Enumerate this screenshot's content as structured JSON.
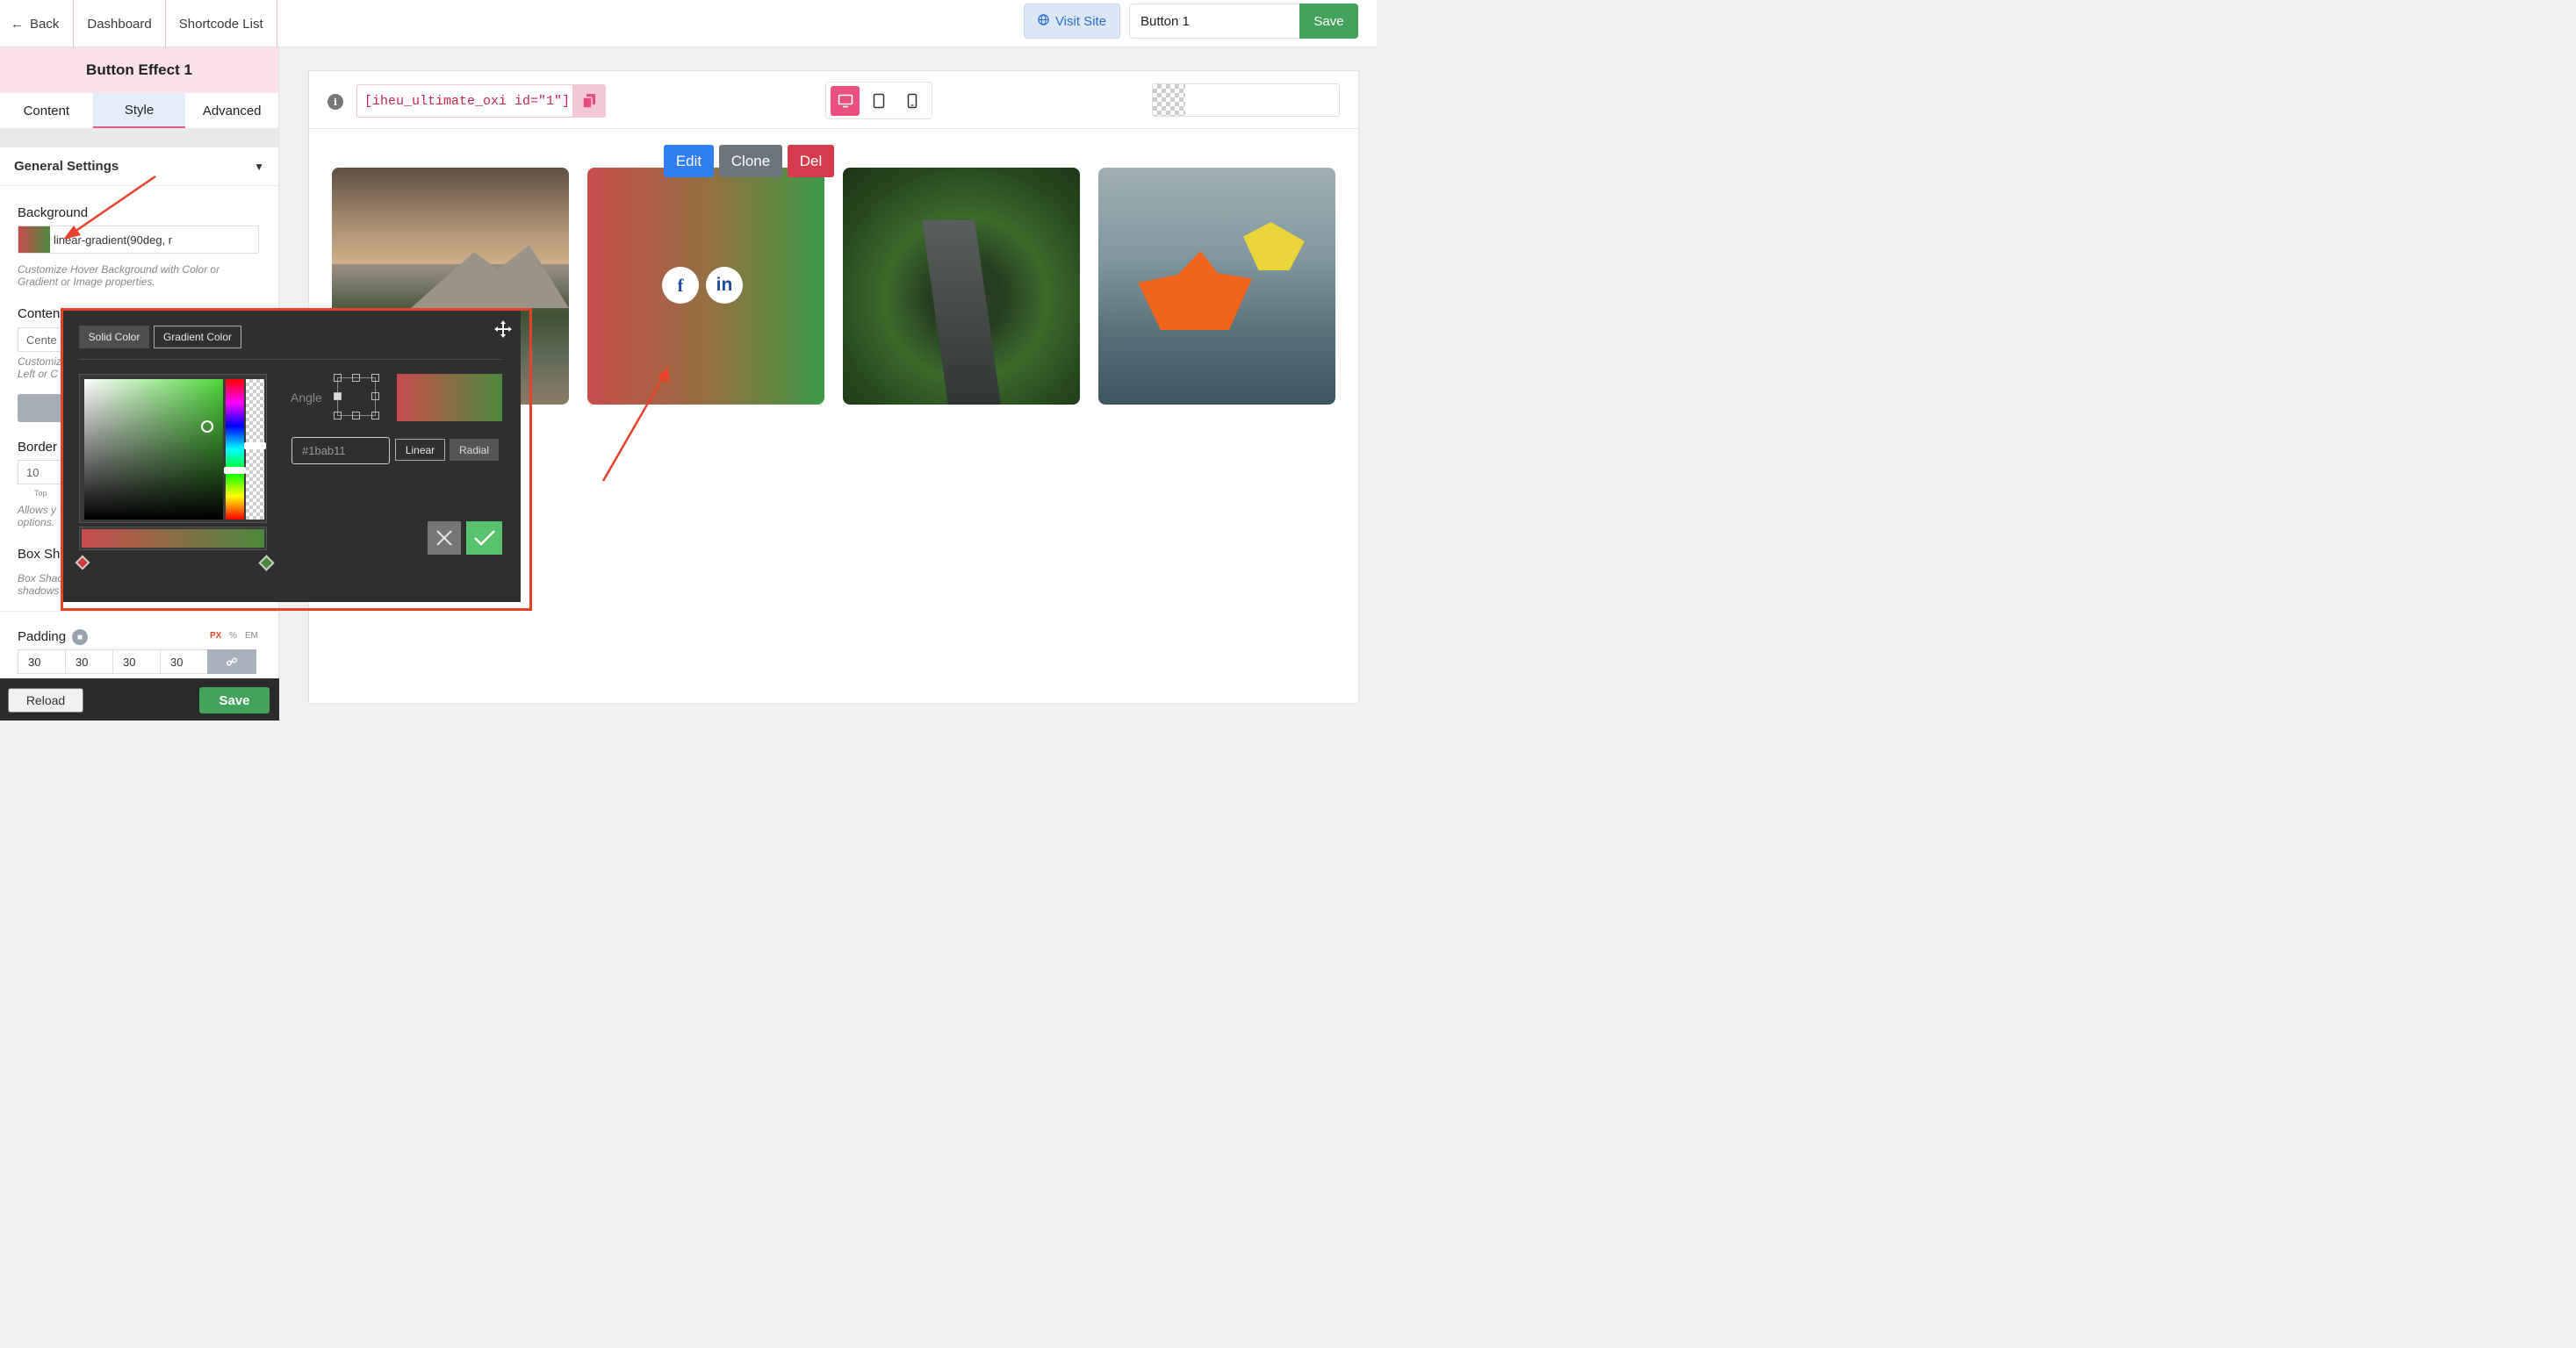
{
  "topbar": {
    "back_label": "Back",
    "dashboard_label": "Dashboard",
    "shortcode_list_label": "Shortcode List",
    "visit_site_label": "Visit Site",
    "title_value": "Button 1",
    "save_label": "Save"
  },
  "panel": {
    "title": "Button Effect 1",
    "tabs": [
      {
        "label": "Content",
        "active": false
      },
      {
        "label": "Style",
        "active": true
      },
      {
        "label": "Advanced",
        "active": false
      }
    ],
    "section_title": "General Settings",
    "background": {
      "label": "Background",
      "value": "linear-gradient(90deg, r",
      "hint_line1": "Customize Hover Background with Color or",
      "hint_line2": "Gradient or Image properties."
    },
    "content_label": "Conten",
    "content_select_value": "Cente",
    "content_hint_line1": "Customiz",
    "content_hint_line2": "Left or C",
    "border_label": "Border",
    "border_value": "10",
    "border_sublabel": "Top",
    "border_hint_line1": "Allows y",
    "border_hint_line2": "options.",
    "box_shadow_label": "Box Sh",
    "box_shadow_hint_line1": "Box Shad",
    "box_shadow_hint_line2": "shadows",
    "padding": {
      "label": "Padding",
      "units": [
        "PX",
        "%",
        "EM"
      ],
      "active_unit": "PX",
      "values": [
        "30",
        "30",
        "30",
        "30"
      ]
    },
    "reload_label": "Reload",
    "save_label": "Save"
  },
  "preview": {
    "shortcode": "[iheu_ultimate_oxi id=\"1\"]",
    "actions": {
      "edit": "Edit",
      "clone": "Clone",
      "del": "Del"
    },
    "social": {
      "facebook": "f",
      "linkedin": "in"
    }
  },
  "color_picker": {
    "solid_label": "Solid Color",
    "gradient_label": "Gradient Color",
    "angle_label": "Angle",
    "hex_placeholder": "#1bab11",
    "linear_label": "Linear",
    "radial_label": "Radial",
    "gradient_start": "#c84c4c",
    "gradient_end": "#4b8a3c"
  },
  "colors": {
    "accent_pink": "#ea4f7e",
    "save_green": "#43a35a",
    "annotation_red": "#e8412a"
  }
}
